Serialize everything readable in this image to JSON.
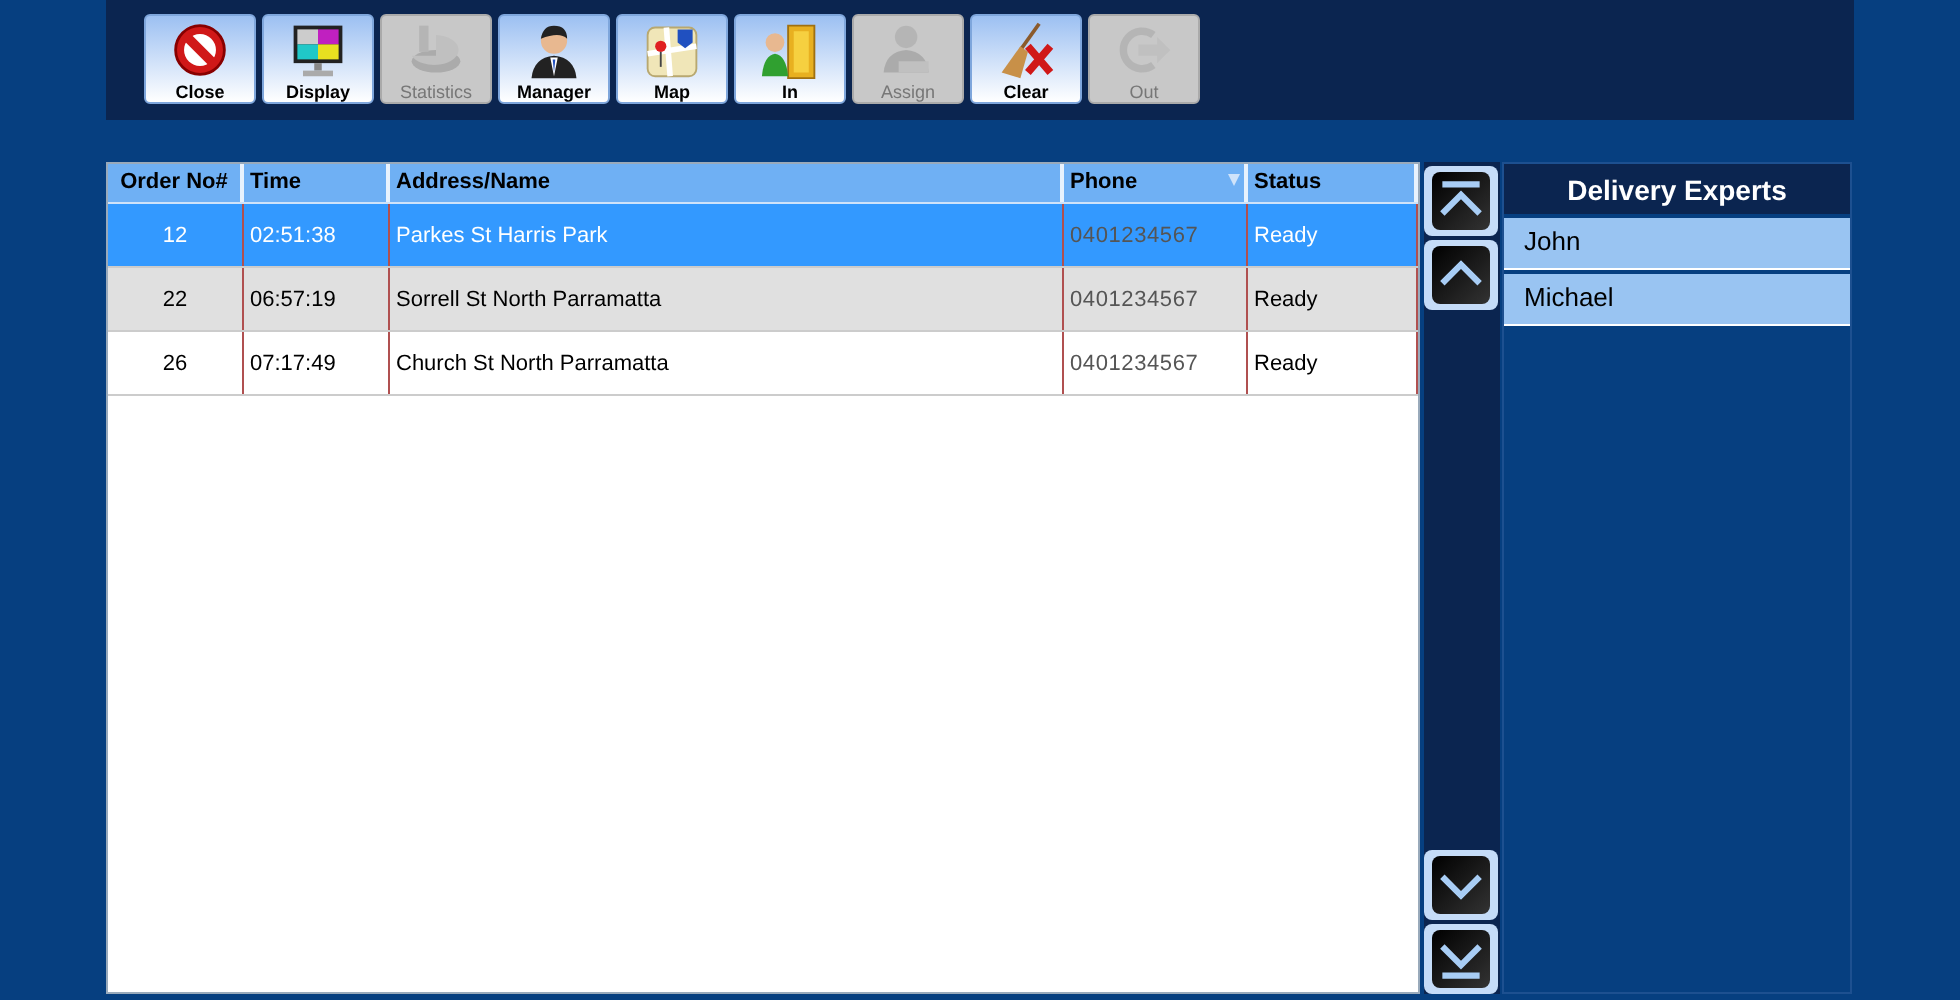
{
  "toolbar": [
    {
      "label": "Close",
      "disabled": false
    },
    {
      "label": "Display",
      "disabled": false
    },
    {
      "label": "Statistics",
      "disabled": true
    },
    {
      "label": "Manager",
      "disabled": false
    },
    {
      "label": "Map",
      "disabled": false
    },
    {
      "label": "In",
      "disabled": false
    },
    {
      "label": "Assign",
      "disabled": true
    },
    {
      "label": "Clear",
      "disabled": false
    },
    {
      "label": "Out",
      "disabled": true
    }
  ],
  "orders": {
    "columns": [
      "Order No#",
      "Time",
      "Address/Name",
      "Phone",
      "Status"
    ],
    "rows": [
      {
        "cells": [
          "12",
          "02:51:38",
          "Parkes St Harris Park",
          "0401234567",
          "Ready"
        ],
        "selected": true
      },
      {
        "cells": [
          "22",
          "06:57:19",
          "Sorrell St North Parramatta",
          "0401234567",
          "Ready"
        ],
        "selected": false
      },
      {
        "cells": [
          "26",
          "07:17:49",
          "Church St North Parramatta",
          "0401234567",
          "Ready"
        ],
        "selected": false
      }
    ]
  },
  "delivery_experts": {
    "title": "Delivery Experts",
    "items": [
      "John",
      "Michael"
    ]
  }
}
